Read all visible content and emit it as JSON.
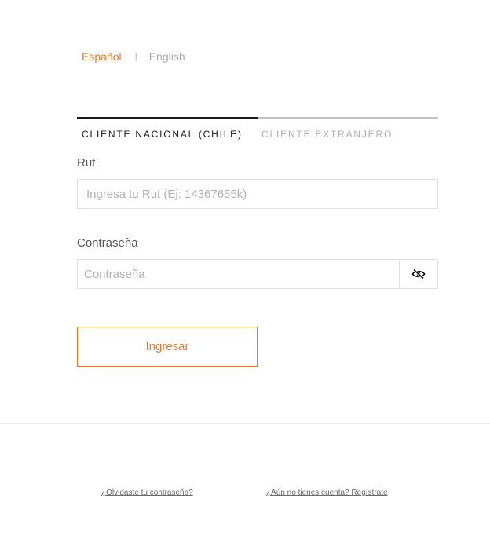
{
  "language": {
    "active": "Español",
    "separator": "|",
    "inactive": "English"
  },
  "tabs": [
    {
      "label": "CLIENTE NACIONAL (CHILE)",
      "selected": true
    },
    {
      "label": "CLIENTE EXTRANJERO",
      "selected": false
    }
  ],
  "form": {
    "rut": {
      "label": "Rut",
      "value": "",
      "placeholder": "Ingresa tu Rut (Ej: 14367655k)"
    },
    "password": {
      "label": "Contraseña",
      "value": "",
      "placeholder": "Contraseña",
      "toggle_icon": "eye-slash-icon"
    },
    "submit_label": "Ingresar"
  },
  "footer": {
    "forgot_password": "¿Olvidaste tu contraseña?",
    "register": "¿Aún no tienes cuenta? Regístrate"
  },
  "colors": {
    "accent": "#e8792b",
    "active_tab": "#1a1a1a",
    "inactive_text": "#b0b0b0",
    "border": "#e2e2e2"
  }
}
